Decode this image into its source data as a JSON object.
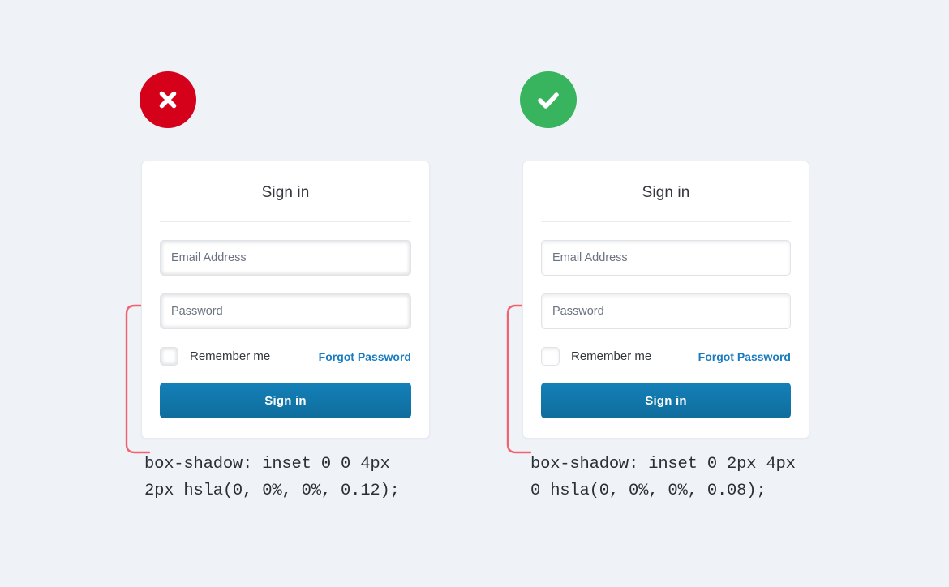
{
  "page": {
    "background_color": "#eff2f7"
  },
  "colors": {
    "bad_badge": "#d50019",
    "good_badge": "#39b45e",
    "connector": "#f4616f",
    "link": "#1a7cc0",
    "button_top": "#1480b8",
    "button_bottom": "#0f6d9c",
    "card_border": "#e7ebf1",
    "input_border": "#dfe3ea",
    "divider": "#e8ecf3"
  },
  "examples": [
    {
      "id": "incorrect",
      "badge": {
        "icon": "x-mark-icon",
        "meaning": "incorrect",
        "color": "#d50019"
      },
      "card": {
        "title": "Sign in",
        "email_field": {
          "placeholder": "Email Address",
          "value": ""
        },
        "password_field": {
          "placeholder": "Password",
          "value": ""
        },
        "remember_label": "Remember me",
        "remember_checked": false,
        "forgot_link": "Forgot Password",
        "submit_label": "Sign in"
      },
      "code_caption": "box-shadow: inset 0 0 4px\n2px hsla(0, 0%, 0%, 0.12);"
    },
    {
      "id": "correct",
      "badge": {
        "icon": "check-mark-icon",
        "meaning": "correct",
        "color": "#39b45e"
      },
      "card": {
        "title": "Sign in",
        "email_field": {
          "placeholder": "Email Address",
          "value": ""
        },
        "password_field": {
          "placeholder": "Password",
          "value": ""
        },
        "remember_label": "Remember me",
        "remember_checked": false,
        "forgot_link": "Forgot Password",
        "submit_label": "Sign in"
      },
      "code_caption": "box-shadow: inset 0 2px 4px\n0 hsla(0, 0%, 0%, 0.08);"
    }
  ]
}
